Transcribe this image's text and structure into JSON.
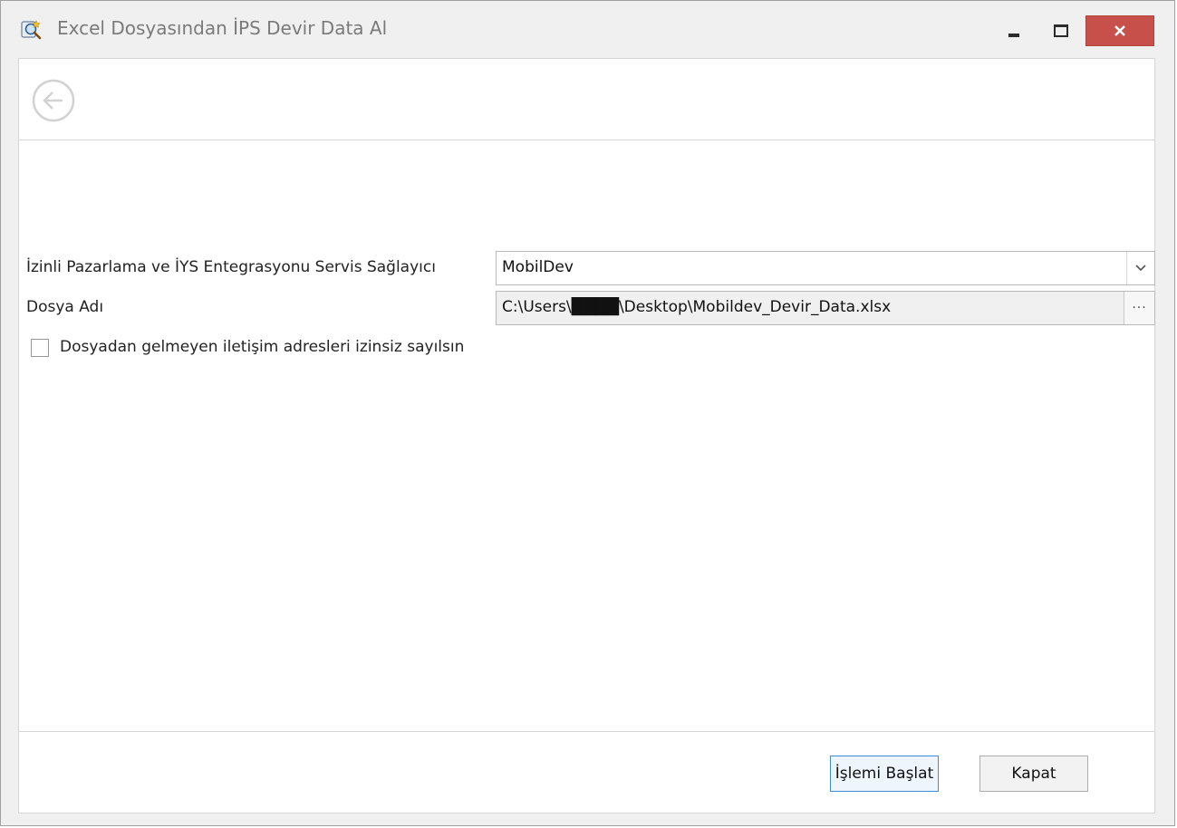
{
  "window": {
    "title": "Excel Dosyasından İPS Devir Data Al"
  },
  "form": {
    "provider_label": "İzinli Pazarlama ve İYS Entegrasyonu Servis Sağlayıcı",
    "provider_value": "MobilDev",
    "file_label": "Dosya Adı",
    "file_value": "C:\\Users\\████\\Desktop\\Mobildev_Devir_Data.xlsx",
    "browse_label": "···",
    "checkbox_label": "Dosyadan gelmeyen iletişim adresleri izinsiz sayılsın",
    "checkbox_checked": false
  },
  "footer": {
    "start_label": "İşlemi Başlat",
    "close_label": "Kapat"
  },
  "colors": {
    "close_button": "#c7504b",
    "primary_button_border": "#3c8fd6"
  }
}
